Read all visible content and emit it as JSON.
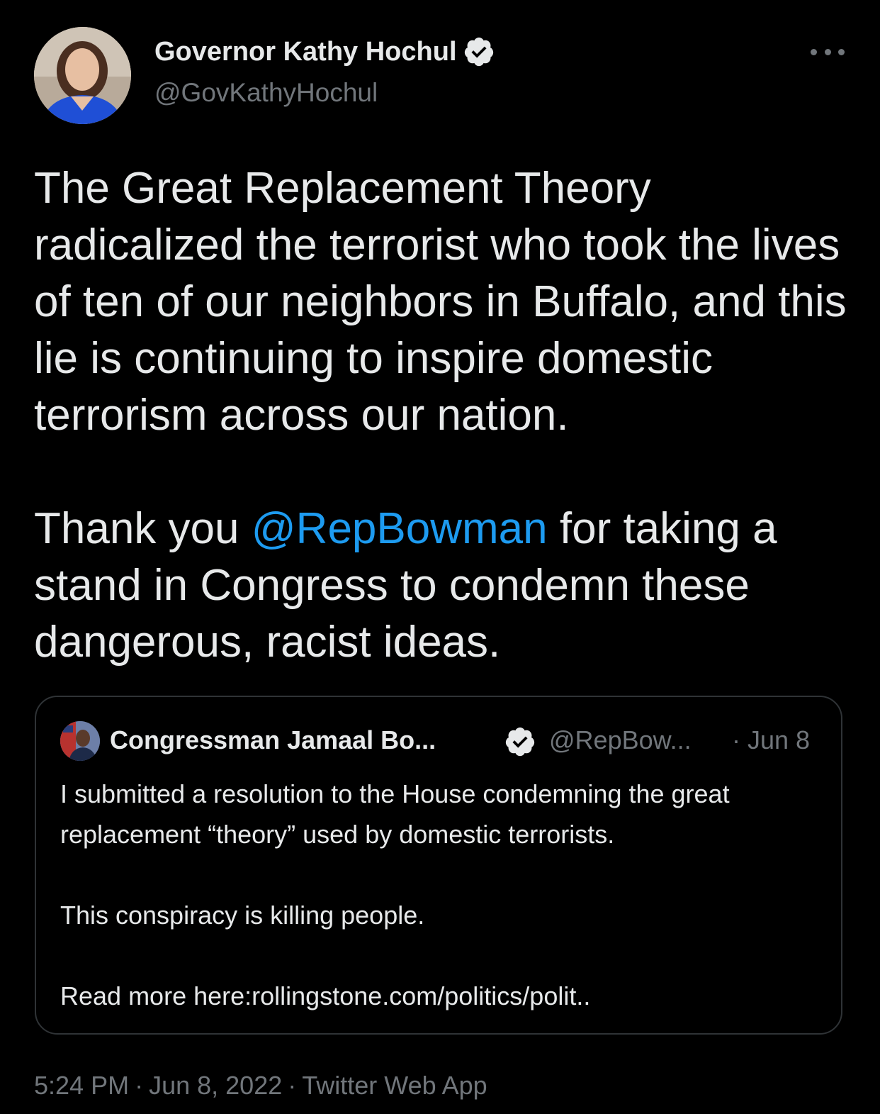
{
  "author": {
    "name": "Governor Kathy Hochul",
    "handle": "@GovKathyHochul",
    "verified": true
  },
  "tweet": {
    "paragraph1": "The Great Replacement Theory radicalized the terrorist who took the lives of ten of our neighbors in Buffalo, and this lie is continuing to inspire domestic terrorism across our nation.",
    "paragraph2_before": "Thank you ",
    "paragraph2_mention": "@RepBowman",
    "paragraph2_after": " for taking a stand in Congress to condemn these dangerous, racist ideas."
  },
  "quote": {
    "name": "Congressman Jamaal Bo...",
    "handle": "@RepBow...",
    "date": "· Jun 8",
    "line1": "I submitted a resolution to the House condemning the great replacement “theory” used by domestic terrorists.",
    "line2": "This conspiracy is killing people.",
    "line3_prefix": "Read more here:",
    "line3_link": "rollingstone.com/politics/polit.."
  },
  "footer": {
    "time": "5:24 PM",
    "date": "Jun 8, 2022",
    "source": "Twitter Web App",
    "separator": "·"
  },
  "colors": {
    "background": "#000000",
    "text": "#e7e9ea",
    "secondary": "#71767b",
    "link": "#1d9bf0",
    "border": "#2f3336"
  },
  "icons": {
    "verified": "verified-badge-icon",
    "more": "more-options-icon"
  }
}
